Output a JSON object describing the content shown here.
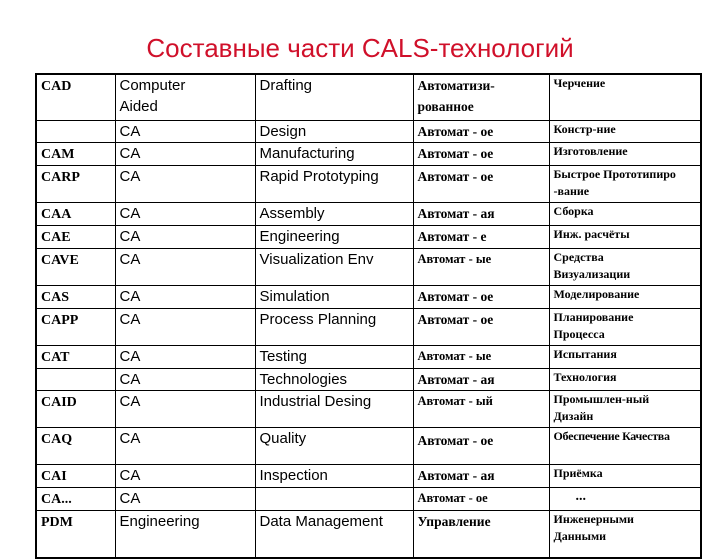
{
  "title": "Составные части CALS-технологий",
  "table": {
    "rows": [
      {
        "abbr": "CAD",
        "first": "Computer",
        "first2": "Aided",
        "term": "Drafting",
        "ru_adj": "Автоматизи-",
        "ru_adj2": "рованное",
        "ru_noun": "Черчение",
        "ru_noun2": ""
      },
      {
        "abbr": "",
        "first": "CA",
        "term": "Design",
        "ru_adj": "Автомат - ое",
        "ru_noun": "Констр-ние",
        "ru_noun2": ""
      },
      {
        "abbr": "CAM",
        "first": "CA",
        "term": "Manufacturing",
        "ru_adj": "Автомат - ое",
        "ru_noun": "Изготовление",
        "ru_noun2": ""
      },
      {
        "abbr": "CARP",
        "first": "CA",
        "term": "Rapid Prototyping",
        "ru_adj": "Автомат - ое",
        "ru_noun": "Быстрое Прототипиро",
        "ru_noun2": "-вание"
      },
      {
        "abbr": "CAA",
        "first": "CA",
        "term": "Assembly",
        "ru_adj": "Автомат - ая",
        "ru_noun": "Сборка",
        "ru_noun2": ""
      },
      {
        "abbr": "CAE",
        "first": "CA",
        "term": "Engineering",
        "ru_adj": "Автомат - е",
        "ru_noun": "Инж. расчёты",
        "ru_noun2": ""
      },
      {
        "abbr": "CAVE",
        "first": "CA",
        "term": "Visualization Env",
        "ru_adj": "Автомат - ые",
        "ru_noun": "Средства",
        "ru_noun2": "Визуализации"
      },
      {
        "abbr": "CAS",
        "first": "CA",
        "term": "Simulation",
        "ru_adj": "Автомат - ое",
        "ru_noun": "Моделирование",
        "ru_noun2": ""
      },
      {
        "abbr": "CAPP",
        "first": "CA",
        "term": "Process Planning",
        "ru_adj": "Автомат - ое",
        "ru_noun": "Планирование",
        "ru_noun2": "Процесса"
      },
      {
        "abbr": "CAT",
        "first": "CA",
        "term": "Testing",
        "ru_adj": "Автомат - ые",
        "ru_noun": "Испытания",
        "ru_noun2": ""
      },
      {
        "abbr": "",
        "first": "CA",
        "term": "Technologies",
        "ru_adj": "Автомат - ая",
        "ru_noun": "Технология",
        "ru_noun2": ""
      },
      {
        "abbr": "CAID",
        "first": "CA",
        "term": "Industrial Desing",
        "ru_adj": "Автомат - ый",
        "ru_noun": "Промышлен-ный",
        "ru_noun2": "Дизайн"
      },
      {
        "abbr": "CAQ",
        "first": "CA",
        "term": "Quality",
        "ru_adj": "Автомат - ое",
        "ru_noun": "Обеспечение Качества",
        "ru_noun2": ""
      },
      {
        "abbr": "CAI",
        "first": "CA",
        "term": "Inspection",
        "ru_adj": "Автомат - ая",
        "ru_noun": "Приёмка",
        "ru_noun2": ""
      },
      {
        "abbr": "CA...",
        "first": "CA",
        "term": "",
        "ru_adj": "Автомат - ое",
        "ru_noun": "...",
        "ru_noun2": ""
      },
      {
        "abbr": "PDM",
        "first": "Engineering",
        "term": "Data Management",
        "ru_adj": "Управление",
        "ru_noun": "Инженерными",
        "ru_noun2": "Данными"
      }
    ]
  }
}
